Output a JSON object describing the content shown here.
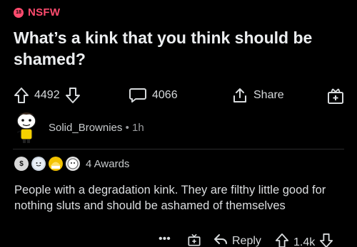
{
  "post": {
    "nsfw_label": "NSFW",
    "nsfw_badge_text": "18",
    "title": "What’s a kink that you think should be shamed?",
    "upvotes": "4492",
    "comments": "4066",
    "share_label": "Share"
  },
  "comment": {
    "username": "Solid_Brownies",
    "separator": "•",
    "age": "1h",
    "awards_label": "4 Awards",
    "body": "People with a degradation kink. They are filthy little good for nothing sluts and should be ashamed of themselves",
    "more_label": "•••",
    "reply_label": "Reply",
    "upvotes": "1.4k"
  },
  "colors": {
    "accent_nsfw": "#ff4b6e",
    "background": "#000000",
    "text": "#d7dadc"
  },
  "icons": [
    "upvote-icon",
    "downvote-icon",
    "comment-icon",
    "share-icon",
    "award-icon",
    "reply-icon"
  ]
}
